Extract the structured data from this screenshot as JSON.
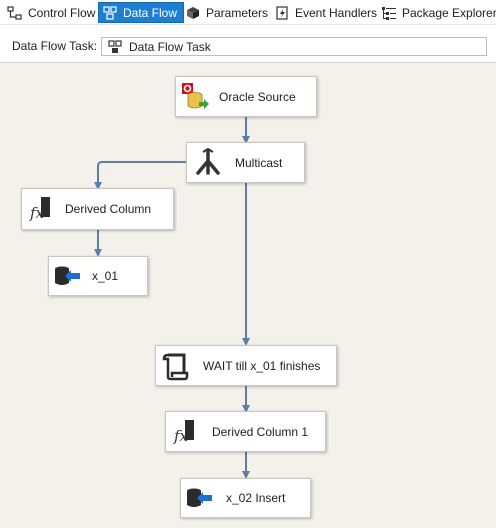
{
  "tabs": [
    {
      "label": "Control Flow",
      "icon": "control-flow-icon",
      "active": false
    },
    {
      "label": "Data Flow",
      "icon": "data-flow-icon",
      "active": true
    },
    {
      "label": "Parameters",
      "icon": "parameters-icon",
      "active": false
    },
    {
      "label": "Event Handlers",
      "icon": "event-handlers-icon",
      "active": false
    },
    {
      "label": "Package Explorer",
      "icon": "package-explorer-icon",
      "active": false
    }
  ],
  "task_selector": {
    "label": "Data Flow Task:",
    "value": "Data Flow Task"
  },
  "components": {
    "oracle_source": {
      "label": "Oracle Source",
      "icon": "oracle-source-icon"
    },
    "multicast": {
      "label": "Multicast",
      "icon": "multicast-icon"
    },
    "derived_column": {
      "label": "Derived Column",
      "icon": "derived-column-icon"
    },
    "x01": {
      "label": "x_01",
      "icon": "destination-icon"
    },
    "wait": {
      "label": "WAIT till x_01 finishes",
      "icon": "script-icon"
    },
    "derived_column_1": {
      "label": "Derived Column 1",
      "icon": "derived-column-icon"
    },
    "x02_insert": {
      "label": "x_02 Insert",
      "icon": "destination-icon"
    }
  },
  "colors": {
    "active_tab": "#1e7ed0",
    "canvas": "#f4f1eb",
    "connector": "#5b7fa6"
  }
}
